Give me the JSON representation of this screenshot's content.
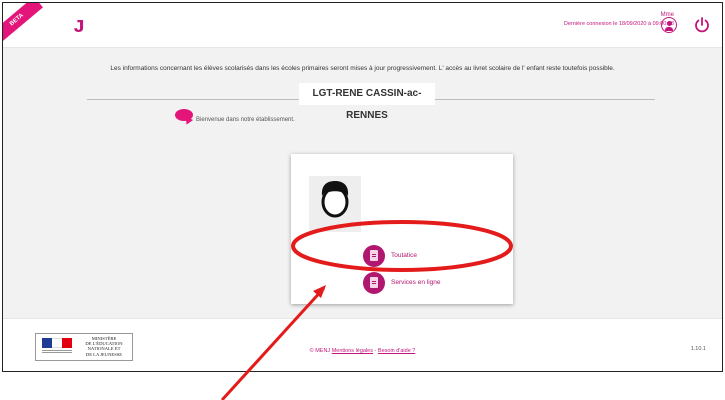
{
  "header": {
    "beta_ribbon": "BETA",
    "logo_icon": "ent-logo-icon",
    "user_name": "Mme",
    "last_connection": "Dernière connexion le 18/09/2020 à 09:00:48",
    "user_icon": "user-profile-icon",
    "power_icon": "power-icon"
  },
  "main": {
    "info_message": "Les informations concernant les élèves scolarisés dans les écoles primaires seront mises à jour progressivement. L' accès au livret scolaire de l' enfant reste toutefois possible.",
    "school_name": "LGT-RENE CASSIN-ac-RENNES",
    "welcome_icon": "speech-bubble-icon",
    "welcome_message": "Bienvenue dans notre établissement.",
    "apps": [
      {
        "label": "Toutatice",
        "icon": "document-icon"
      },
      {
        "label": "Services en ligne",
        "icon": "document-icon"
      }
    ]
  },
  "footer": {
    "ministry_lines": [
      "MINISTÈRE",
      "DE L'ÉDUCATION",
      "NATIONALE ET",
      "DE LA JEUNESSE"
    ],
    "copyright": "© MENJ",
    "legal_link": "Mentions légales",
    "separator": "-",
    "help_link": "Besoin d'aide ?",
    "version": "1.10.1"
  },
  "colors": {
    "accent": "#c3157a",
    "app_icon": "#b0176f",
    "annotation": "#e41b1b",
    "background": "#f2f2f2"
  }
}
